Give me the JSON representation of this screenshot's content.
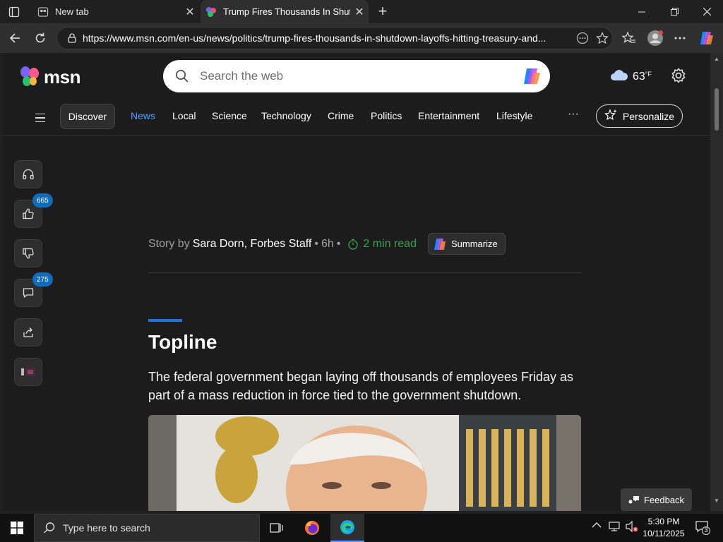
{
  "browser": {
    "tabs": [
      {
        "title": "New tab",
        "active": false
      },
      {
        "title": "Trump Fires Thousands In Shutdo",
        "active": true
      }
    ],
    "url": "https://www.msn.com/en-us/news/politics/trump-fires-thousands-in-shutdown-layoffs-hitting-treasury-and..."
  },
  "msn": {
    "logo_text": "msn",
    "search_placeholder": "Search the web",
    "weather": {
      "temp": "63",
      "unit": "°F"
    },
    "nav": {
      "discover": "Discover",
      "items": [
        "News",
        "Local",
        "Science",
        "Technology",
        "Crime",
        "Politics",
        "Entertainment",
        "Lifestyle"
      ],
      "active": "News",
      "more": "···",
      "personalize": "Personalize"
    }
  },
  "rail": {
    "likes_count": "665",
    "comments_count": "275"
  },
  "article": {
    "story_by_prefix": "Story by",
    "author": "Sara Dorn, Forbes Staff",
    "age": "6h",
    "read_time": "2 min read",
    "summarize": "Summarize",
    "section_heading": "Topline",
    "lead": "The federal government began laying off thousands of employees Friday as part of a mass reduction in force tied to the government shutdown."
  },
  "feedback": "Feedback",
  "taskbar": {
    "search_placeholder": "Type here to search",
    "time": "5:30 PM",
    "date": "10/11/2025",
    "notifications": "3"
  },
  "colors": {
    "accent_blue": "#4ea2ff",
    "read_time_green": "#3aa04a",
    "badge_blue": "#0f6cbd"
  }
}
